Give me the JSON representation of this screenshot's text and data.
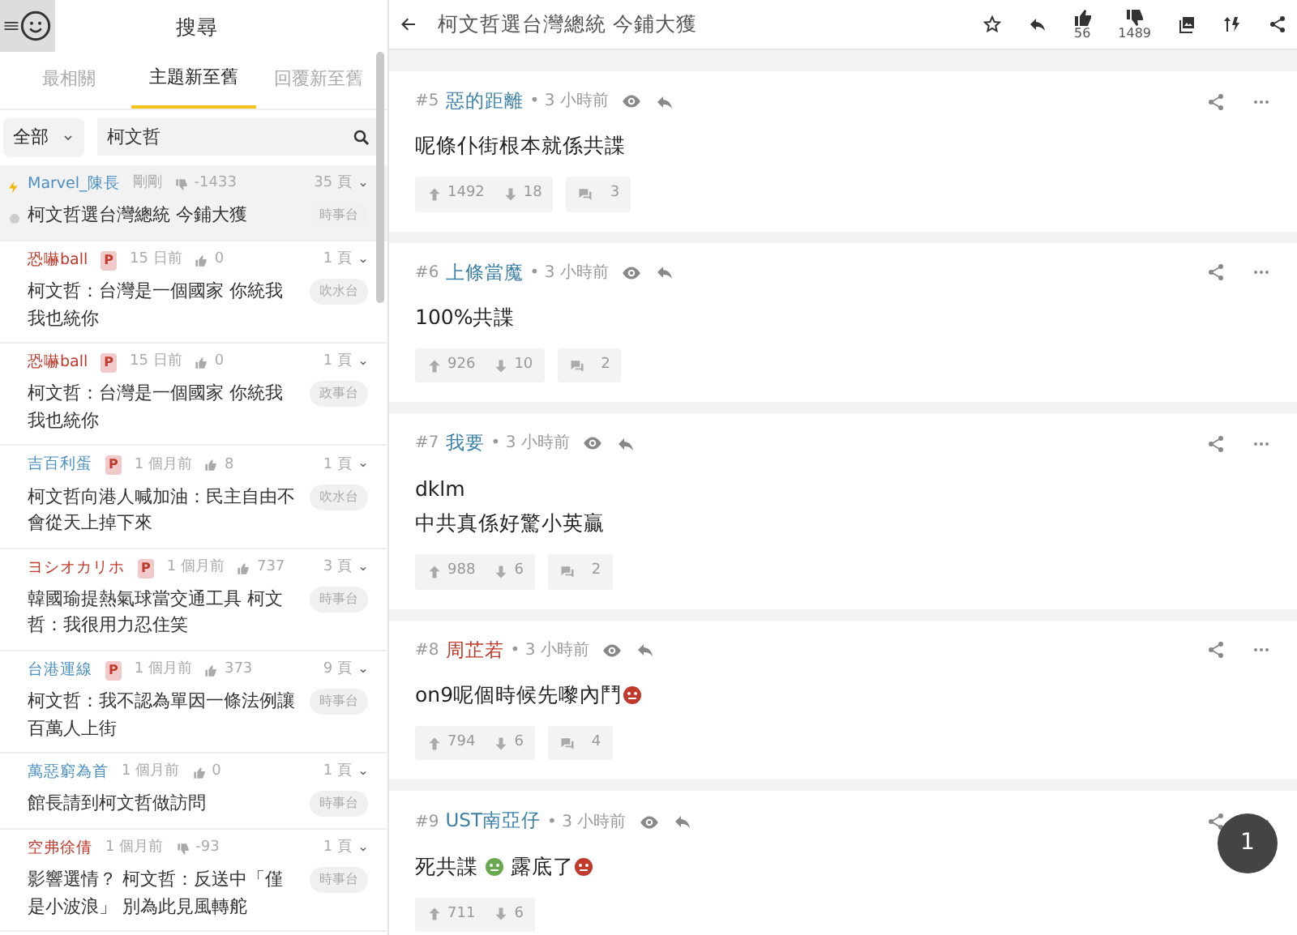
{
  "sidebar": {
    "title": "搜尋",
    "tabs": [
      {
        "label": "最相關",
        "selected": false
      },
      {
        "label": "主題新至舊",
        "selected": true
      },
      {
        "label": "回覆新至舊",
        "selected": false
      }
    ],
    "filter": {
      "value": "全部"
    },
    "search": {
      "value": "柯文哲"
    },
    "items": [
      {
        "author": "Marvel_陳長",
        "color": "#4a90c2",
        "meta": "剛剛",
        "negative": true,
        "score": "-1433",
        "pages": "35 頁",
        "title": "柯文哲選台灣總統 今鋪大獲",
        "tag": "時事台",
        "selected": true
      },
      {
        "author": "恐嚇ball",
        "color": "#c0392b",
        "badge": "P",
        "meta": "15 日前",
        "negative": false,
        "score": "0",
        "pages": "1 頁",
        "title": "柯文哲：台灣是一個國家 你統我我也統你",
        "tag": "吹水台",
        "selected": false
      },
      {
        "author": "恐嚇ball",
        "color": "#c0392b",
        "badge": "P",
        "meta": "15 日前",
        "negative": false,
        "score": "0",
        "pages": "1 頁",
        "title": "柯文哲：台灣是一個國家 你統我我也統你",
        "tag": "政事台",
        "selected": false
      },
      {
        "author": "吉百利蛋",
        "color": "#4a90c2",
        "badge": "P",
        "meta": "1 個月前",
        "negative": false,
        "score": "8",
        "pages": "1 頁",
        "title": "柯文哲向港人喊加油：民主自由不會從天上掉下來",
        "tag": "吹水台",
        "selected": false
      },
      {
        "author": "ヨシオカリホ",
        "color": "#c0392b",
        "badge": "P",
        "meta": "1 個月前",
        "negative": false,
        "score": "737",
        "pages": "3 頁",
        "title": "韓國瑜提熱氣球當交通工具 柯文哲：我很用力忍住笑",
        "tag": "時事台",
        "selected": false
      },
      {
        "author": "台港運線",
        "color": "#4a90c2",
        "badge": "P",
        "meta": "1 個月前",
        "negative": false,
        "score": "373",
        "pages": "9 頁",
        "title": "柯文哲：我不認為單因一條法例讓百萬人上街",
        "tag": "時事台",
        "selected": false
      },
      {
        "author": "萬惡窮為首",
        "color": "#4a90c2",
        "meta": "1 個月前",
        "negative": false,
        "score": "0",
        "pages": "1 頁",
        "title": "館長請到柯文哲做訪問",
        "tag": "時事台",
        "selected": false
      },
      {
        "author": "空弗徐倩",
        "color": "#c0392b",
        "meta": "1 個月前",
        "negative": true,
        "score": "-93",
        "pages": "1 頁",
        "title": "影響選情？ 柯文哲：反送中「僅是小波浪」 別為此見風轉舵",
        "tag": "時事台",
        "selected": false
      }
    ]
  },
  "thread": {
    "title": "柯文哲選台灣總統 今鋪大獲",
    "likes": "56",
    "dislikes": "1489",
    "posts": [
      {
        "number": "#5",
        "author": "惡的距離",
        "color": "#3a7fa8",
        "time": "• 3 小時前",
        "lines": [
          [
            {
              "kind": "text",
              "text": "呢條仆街根本就係共諜"
            }
          ]
        ],
        "up": "1492",
        "down": "18",
        "replies": "3"
      },
      {
        "number": "#6",
        "author": "上條當魔",
        "color": "#3a7fa8",
        "time": "• 3 小時前",
        "lines": [
          [
            {
              "kind": "text",
              "text": "100%共諜"
            }
          ]
        ],
        "up": "926",
        "down": "10",
        "replies": "2"
      },
      {
        "number": "#7",
        "author": "我要",
        "color": "#3a7fa8",
        "time": "• 3 小時前",
        "lines": [
          [
            {
              "kind": "text",
              "text": "dklm"
            }
          ],
          [
            {
              "kind": "text",
              "text": "中共真係好驚小英贏"
            }
          ]
        ],
        "up": "988",
        "down": "6",
        "replies": "2"
      },
      {
        "number": "#8",
        "author": "周芷若",
        "color": "#c0392b",
        "time": "• 3 小時前",
        "lines": [
          [
            {
              "kind": "text",
              "text": "on9呢個時候先嚟內鬥"
            },
            {
              "kind": "emoji",
              "color": "#c0392b"
            }
          ]
        ],
        "up": "794",
        "down": "6",
        "replies": "4"
      },
      {
        "number": "#9",
        "author": "UST南亞仔",
        "color": "#3a7fa8",
        "time": "• 3 小時前",
        "lines": [
          [
            {
              "kind": "text",
              "text": "死共諜 "
            },
            {
              "kind": "emoji",
              "color": "#6aa84f"
            },
            {
              "kind": "text",
              "text": " 露底了"
            },
            {
              "kind": "emoji",
              "color": "#c0392b"
            }
          ]
        ],
        "up": "711",
        "down": "6"
      }
    ],
    "page_button": "1"
  }
}
